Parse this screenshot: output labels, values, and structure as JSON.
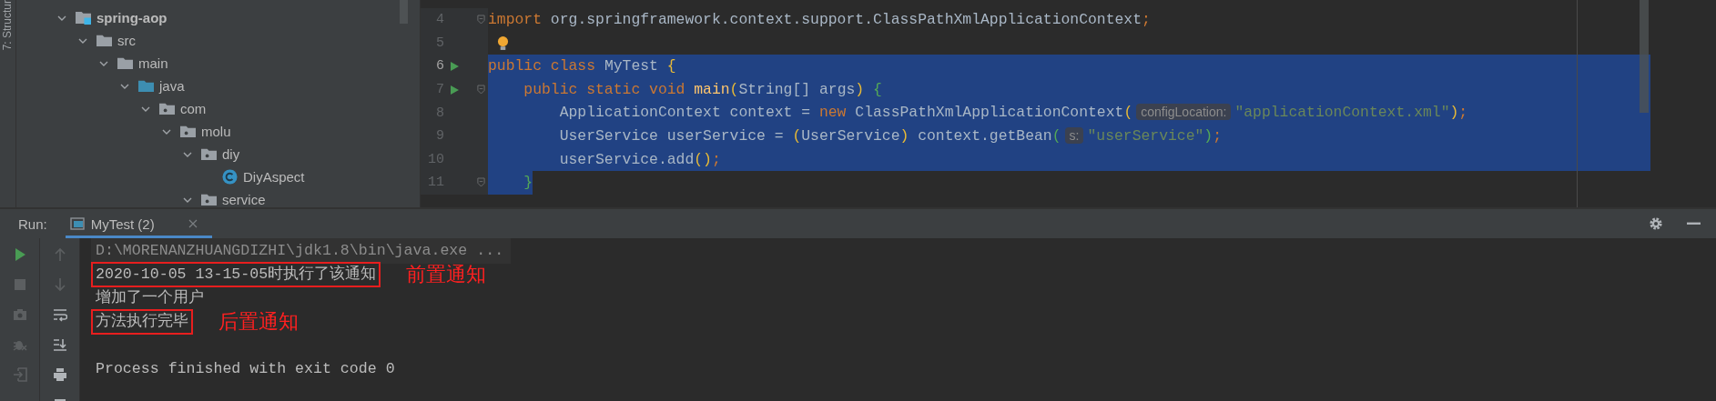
{
  "sidebar_tab": {
    "label": "7: Structur"
  },
  "project_tree": {
    "items": [
      {
        "name": "spring-aop",
        "kind": "module",
        "expanded": true,
        "children": [
          {
            "name": "src",
            "kind": "folder",
            "expanded": true,
            "children": [
              {
                "name": "main",
                "kind": "folder",
                "expanded": true,
                "children": [
                  {
                    "name": "java",
                    "kind": "source",
                    "expanded": true,
                    "children": [
                      {
                        "name": "com",
                        "kind": "package",
                        "expanded": true,
                        "children": [
                          {
                            "name": "molu",
                            "kind": "package",
                            "expanded": true,
                            "children": [
                              {
                                "name": "diy",
                                "kind": "package",
                                "expanded": true,
                                "children": [
                                  {
                                    "name": "DiyAspect",
                                    "kind": "class"
                                  }
                                ]
                              },
                              {
                                "name": "service",
                                "kind": "package",
                                "expanded": true
                              }
                            ]
                          }
                        ]
                      }
                    ]
                  }
                ]
              }
            ]
          }
        ]
      }
    ]
  },
  "editor": {
    "lines": [
      {
        "number": "4",
        "fold": true,
        "run": false,
        "bulb": false,
        "current": false,
        "selected": false,
        "tokens": [
          {
            "kind": "keyword",
            "text": "import"
          },
          {
            "kind": "plain",
            "text": " org.springframework.context.support.ClassPathXmlApplicationContext"
          },
          {
            "kind": "punct",
            "text": ";"
          }
        ]
      },
      {
        "number": "5",
        "fold": false,
        "run": false,
        "bulb": true,
        "current": false,
        "selected": false
      },
      {
        "number": "6",
        "fold": false,
        "run": true,
        "bulb": false,
        "current": true,
        "selected": true,
        "to_eol": true,
        "tokens": [
          {
            "kind": "keyword",
            "text": "public class"
          },
          {
            "kind": "plain",
            "text": " MyTest "
          },
          {
            "kind": "bracket1",
            "text": "{"
          }
        ]
      },
      {
        "number": "7",
        "fold": true,
        "run": true,
        "bulb": false,
        "current": false,
        "selected": true,
        "to_eol": true,
        "tokens": [
          {
            "kind": "keyword",
            "text": "    public static void"
          },
          {
            "kind": "method",
            "text": " main"
          },
          {
            "kind": "bracket1",
            "text": "("
          },
          {
            "kind": "plain",
            "text": "String[] args"
          },
          {
            "kind": "bracket1",
            "text": ")"
          },
          {
            "kind": "bracket2",
            "text": " {"
          }
        ]
      },
      {
        "number": "8",
        "fold": false,
        "run": false,
        "bulb": false,
        "current": false,
        "selected": true,
        "to_eol": true,
        "tokens": [
          {
            "kind": "plain",
            "text": "        ApplicationContext context = "
          },
          {
            "kind": "keyword",
            "text": "new"
          },
          {
            "kind": "plain",
            "text": " ClassPathXmlApplicationContext"
          },
          {
            "kind": "bracket1",
            "text": "("
          },
          {
            "kind": "hint",
            "text": "configLocation:"
          },
          {
            "kind": "string",
            "text": "\"applicationContext.xml\""
          },
          {
            "kind": "bracket1",
            "text": ")"
          },
          {
            "kind": "punct",
            "text": ";"
          }
        ]
      },
      {
        "number": "9",
        "fold": false,
        "run": false,
        "bulb": false,
        "current": false,
        "selected": true,
        "to_eol": true,
        "tokens": [
          {
            "kind": "plain",
            "text": "        UserService userService = "
          },
          {
            "kind": "bracket1",
            "text": "("
          },
          {
            "kind": "plain",
            "text": "UserService"
          },
          {
            "kind": "bracket1",
            "text": ")"
          },
          {
            "kind": "plain",
            "text": " context.getBean"
          },
          {
            "kind": "bracket2",
            "text": "("
          },
          {
            "kind": "hint",
            "text": "s:"
          },
          {
            "kind": "string",
            "text": "\"userService\""
          },
          {
            "kind": "bracket2",
            "text": ")"
          },
          {
            "kind": "punct",
            "text": ";"
          }
        ]
      },
      {
        "number": "10",
        "fold": false,
        "run": false,
        "bulb": false,
        "current": false,
        "selected": true,
        "to_eol": true,
        "tokens": [
          {
            "kind": "plain",
            "text": "        userService.add"
          },
          {
            "kind": "bracket1",
            "text": "()"
          },
          {
            "kind": "punct",
            "text": ";"
          }
        ]
      },
      {
        "number": "11",
        "fold": true,
        "run": false,
        "bulb": false,
        "current": false,
        "selected": true,
        "to_eol": false,
        "tokens": [
          {
            "kind": "bracket2",
            "text": "    }"
          }
        ]
      }
    ]
  },
  "run_panel": {
    "label": "Run:",
    "tab": {
      "title": "MyTest (2)",
      "selected": true
    },
    "console": {
      "lines": [
        {
          "kind": "command",
          "text": "D:\\MORENANZHUANGDIZHI\\jdk1.8\\bin\\java.exe ...",
          "boxed": false
        },
        {
          "kind": "output",
          "text": "2020-10-05 13-15-05时执行了该通知",
          "boxed": true,
          "annotation": "前置通知"
        },
        {
          "kind": "output",
          "text": "增加了一个用户",
          "boxed": false
        },
        {
          "kind": "output",
          "text": "方法执行完毕",
          "boxed": true,
          "annotation": "后置通知"
        },
        {
          "kind": "exit",
          "text": "Process finished with exit code 0",
          "boxed": false
        }
      ]
    }
  }
}
